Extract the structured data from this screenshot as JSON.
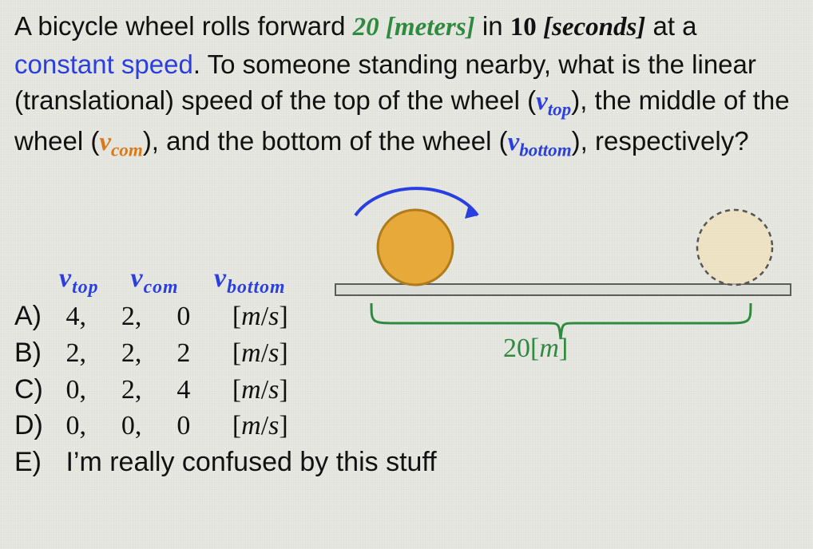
{
  "question": {
    "p1a": "A bicycle wheel rolls forward ",
    "dist_val": "20",
    "dist_unit": " [meters]",
    "p1b": " in ",
    "time_val": "10",
    "time_unit": " [seconds]",
    "p1c": " at a ",
    "const": "constant speed",
    "p1d": ".  To someone standing nearby, what is the linear (translational) speed of the top of the wheel (",
    "vtop_sym": "v",
    "vtop_sub": "top",
    "p1e": "), the middle of the wheel (",
    "vcom_sym": "v",
    "vcom_sub": "com",
    "p1f": "), and the bottom of the wheel (",
    "vbot_sym": "v",
    "vbot_sub": "bottom",
    "p1g": "), respectively?"
  },
  "headers": {
    "h1_sym": "v",
    "h1_sub": "top",
    "h2_sym": "v",
    "h2_sub": "com",
    "h3_sym": "v",
    "h3_sub": "bottom"
  },
  "options": {
    "A": {
      "label": "A)",
      "v1": "4,",
      "v2": "2,",
      "v3": "0",
      "unit": "[m/s]"
    },
    "B": {
      "label": "B)",
      "v1": "2,",
      "v2": "2,",
      "v3": "2",
      "unit": "[m/s]"
    },
    "C": {
      "label": "C)",
      "v1": "0,",
      "v2": "2,",
      "v3": "4",
      "unit": "[m/s]"
    },
    "D": {
      "label": "D)",
      "v1": "0,",
      "v2": "0,",
      "v3": "0",
      "unit": "[m/s]"
    },
    "E": {
      "label": "E)",
      "text": "I’m really confused by this stuff"
    }
  },
  "diagram": {
    "distance_label": "20[m]",
    "unit_m": "m"
  }
}
